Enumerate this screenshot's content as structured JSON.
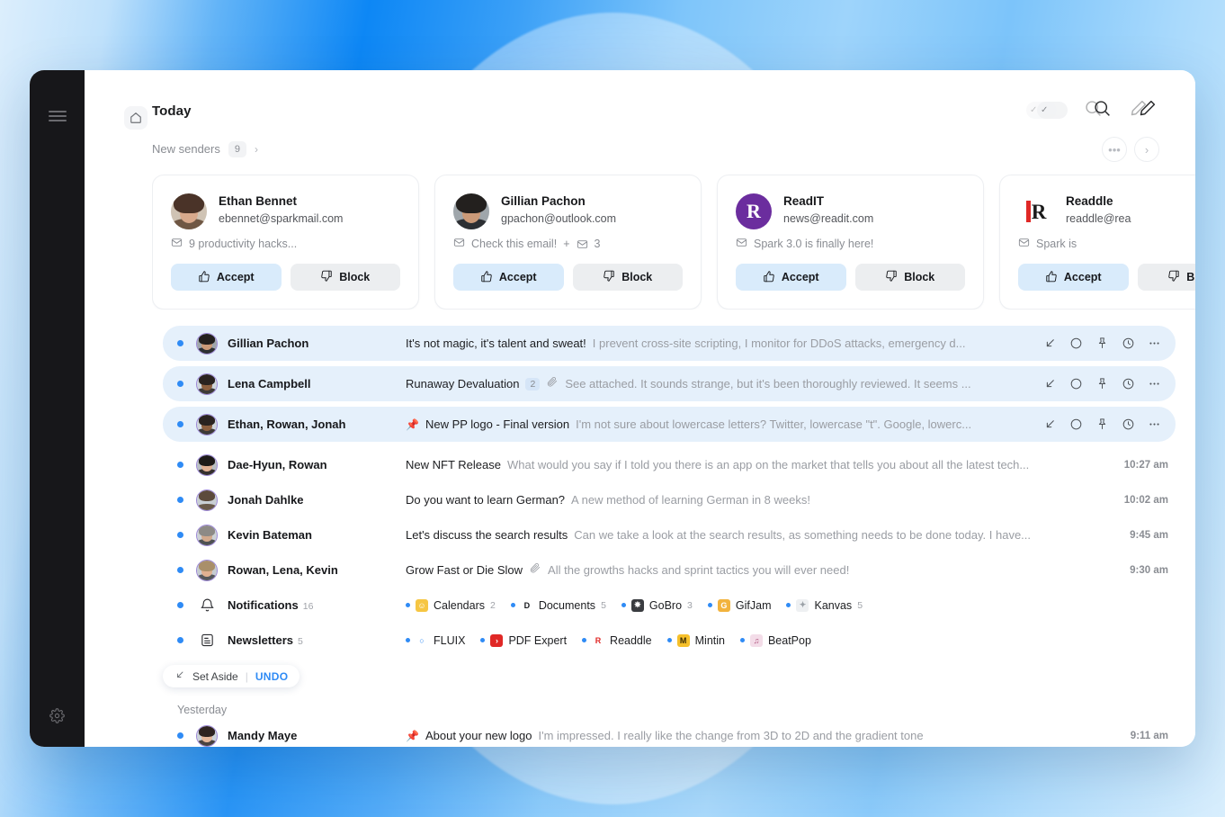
{
  "window": {
    "rail": {
      "menu_icon": "hamburger-icon",
      "settings_icon": "gear-icon"
    },
    "home_icon": "home-icon"
  },
  "header": {
    "title": "Today",
    "actions": {
      "toggle_icon": "checkmark-toggle-icon",
      "search_icon": "search-icon",
      "compose_icon": "pencil-compose-icon"
    }
  },
  "new_senders": {
    "label": "New senders",
    "count": "9",
    "chevron": "chevron-right-icon",
    "more_label": "•••",
    "next_label": "›",
    "cards": [
      {
        "name": "Ethan Bennet",
        "email": "ebennet@sparkmail.com",
        "subject": "9 productivity hacks...",
        "extra": "",
        "accept": "Accept",
        "block": "Block",
        "avatar_kind": "photo-woman-curly",
        "colors": {
          "hair": "#4a3328",
          "skin": "#d8a98c",
          "bg": "#cfc3b4",
          "body": "#6f5744"
        }
      },
      {
        "name": "Gillian Pachon",
        "email": "gpachon@outlook.com",
        "subject": "Check this email!",
        "extra": "3",
        "accept": "Accept",
        "block": "Block",
        "avatar_kind": "photo-man-glasses",
        "colors": {
          "hair": "#23201e",
          "skin": "#cb9a78",
          "bg": "#9fa6ab",
          "body": "#2c2f33"
        }
      },
      {
        "name": "ReadIT",
        "email": "news@readit.com",
        "subject": "Spark 3.0 is finally here!",
        "extra": "",
        "accept": "Accept",
        "block": "Block",
        "avatar_kind": "logo-readit",
        "colors": {
          "brand": "#6b2d9e"
        }
      },
      {
        "name": "Readdle",
        "email": "readdle@rea",
        "subject": "Spark is",
        "extra": "",
        "accept": "Accept",
        "block": "Block",
        "avatar_kind": "logo-readdle",
        "colors": {
          "brand": "#e02826",
          "dark": "#1b1b1b"
        }
      }
    ]
  },
  "list": {
    "rows": [
      {
        "selected": true,
        "unread": true,
        "sender": "Gillian Pachon",
        "subject": "It's not magic, it's talent and sweat!",
        "preview": "I prevent cross-site scripting, I monitor for DDoS attacks, emergency d...",
        "thread": "",
        "attachment": false,
        "pinned": false,
        "time": "",
        "avatar_kind": "photo-man-glasses",
        "colors": {
          "hair": "#23201e",
          "skin": "#cb9a78",
          "bg": "#9fa6ab",
          "body": "#2c2f33"
        }
      },
      {
        "selected": true,
        "unread": true,
        "sender": "Lena Campbell",
        "subject": "Runaway Devaluation",
        "preview": "See attached. It sounds strange, but it's been thoroughly reviewed. It seems ...",
        "thread": "2",
        "attachment": true,
        "pinned": false,
        "time": "",
        "avatar_kind": "photo-woman-afro",
        "colors": {
          "hair": "#2a2320",
          "skin": "#8c5f3f",
          "bg": "#cfd6dc",
          "body": "#3d3a38"
        }
      },
      {
        "selected": true,
        "unread": true,
        "sender": "Ethan, Rowan, Jonah",
        "subject": "New PP logo - Final version",
        "preview": "I'm not sure about lowercase letters? Twitter, lowercase \"t\". Google, lowerc...",
        "thread": "",
        "attachment": false,
        "pinned": true,
        "time": "",
        "avatar_kind": "photo-woman-afro",
        "colors": {
          "hair": "#2a2320",
          "skin": "#8c5f3f",
          "bg": "#cfd6dc",
          "body": "#3d3a38"
        }
      },
      {
        "selected": false,
        "unread": true,
        "sender": "Dae-Hyun, Rowan",
        "subject": "New NFT Release",
        "preview": "What would you say if I told you there is an app on the market that tells you about all the latest tech...",
        "thread": "",
        "attachment": false,
        "pinned": false,
        "time": "10:27 am",
        "avatar_kind": "photo-woman-dark",
        "colors": {
          "hair": "#1d1a19",
          "skin": "#e0b094",
          "bg": "#b9bfc4",
          "body": "#35302e"
        }
      },
      {
        "selected": false,
        "unread": true,
        "sender": "Jonah Dahlke",
        "subject": "Do you want to learn German?",
        "preview": "A new method of learning German in 8 weeks!",
        "thread": "",
        "attachment": false,
        "pinned": false,
        "time": "10:02 am",
        "avatar_kind": "photo-man-beard",
        "colors": {
          "hair": "#5c4a3c",
          "skin": "#d9a branch",
          "bg": "#c9cfd4",
          "body": "#6a5a4a"
        }
      },
      {
        "selected": false,
        "unread": true,
        "sender": "Kevin Bateman",
        "subject": "Let's discuss the search results",
        "preview": "Can we take a look at the search results, as something needs to be done today. I have...",
        "thread": "",
        "attachment": false,
        "pinned": false,
        "time": "9:45 am",
        "avatar_kind": "photo-man-gray",
        "colors": {
          "hair": "#8d8a86",
          "skin": "#d2a98d",
          "bg": "#cdd2d6",
          "body": "#4e5153"
        }
      },
      {
        "selected": false,
        "unread": true,
        "sender": "Rowan, Lena, Kevin",
        "subject": "Grow Fast or Die Slow",
        "preview": "All the growths hacks and sprint tactics you will ever need!",
        "thread": "",
        "attachment": true,
        "pinned": false,
        "time": "9:30 am",
        "avatar_kind": "photo-man-blond",
        "colors": {
          "hair": "#a98f6a",
          "skin": "#e0b191",
          "bg": "#c6ccd1",
          "body": "#55585b"
        }
      }
    ],
    "groups": [
      {
        "icon": "bell-icon",
        "name": "Notifications",
        "count": "16",
        "chips": [
          {
            "label": "Calendars",
            "count": "2",
            "icon_text": "☺",
            "icon_bg": "#f6c643",
            "icon_fg": "#ffffff"
          },
          {
            "label": "Documents",
            "count": "5",
            "icon_text": "D",
            "icon_bg": "#ffffff",
            "icon_fg": "#16181c"
          },
          {
            "label": "GoBro",
            "count": "3",
            "icon_text": "✸",
            "icon_bg": "#3a3c40",
            "icon_fg": "#ffffff"
          },
          {
            "label": "GifJam",
            "count": "",
            "icon_text": "G",
            "icon_bg": "#f2b33d",
            "icon_fg": "#ffffff"
          },
          {
            "label": "Kanvas",
            "count": "5",
            "icon_text": "✦",
            "icon_bg": "#eef0f2",
            "icon_fg": "#9aa0a6"
          }
        ]
      },
      {
        "icon": "newsletter-icon",
        "name": "Newsletters",
        "count": "5",
        "chips": [
          {
            "label": "FLUIX",
            "count": "",
            "icon_text": "○",
            "icon_bg": "#ffffff",
            "icon_fg": "#2f8bf5"
          },
          {
            "label": "PDF Expert",
            "count": "",
            "icon_text": "›",
            "icon_bg": "#e02826",
            "icon_fg": "#ffffff"
          },
          {
            "label": "Readdle",
            "count": "",
            "icon_text": "R",
            "icon_bg": "#ffffff",
            "icon_fg": "#e02826"
          },
          {
            "label": "Mintin",
            "count": "",
            "icon_text": "M",
            "icon_bg": "#f6c02a",
            "icon_fg": "#3a2c05"
          },
          {
            "label": "BeatPop",
            "count": "",
            "icon_text": "♫",
            "icon_bg": "#f3dce8",
            "icon_fg": "#b0557f"
          }
        ]
      }
    ],
    "undo": {
      "icon": "set-aside-icon",
      "label": "Set Aside",
      "undo_label": "UNDO"
    },
    "yesterday_label": "Yesterday",
    "yesterday_rows": [
      {
        "selected": false,
        "unread": true,
        "sender": "Mandy Maye",
        "subject": "About your new logo",
        "preview": "I'm impressed. I really like the change from 3D to 2D and the gradient tone",
        "thread": "",
        "attachment": false,
        "pinned": true,
        "time": "9:11 am",
        "avatar_kind": "photo-woman-long",
        "colors": {
          "hair": "#2e2320",
          "skin": "#e5b89c",
          "bg": "#ccd3d9",
          "body": "#4a4340"
        }
      }
    ],
    "row_actions": {
      "set_aside": "set-aside-icon",
      "mark_read": "circle-icon",
      "pin": "pin-icon",
      "snooze": "clock-icon",
      "more": "more-icon"
    }
  },
  "colors": {
    "accent": "#2f8bf5",
    "selected_row": "#e5f0fb",
    "accept_button": "#d9ebfb",
    "block_button": "#eceef0",
    "rail": "#17171a",
    "pin": "#f2ae3a"
  }
}
